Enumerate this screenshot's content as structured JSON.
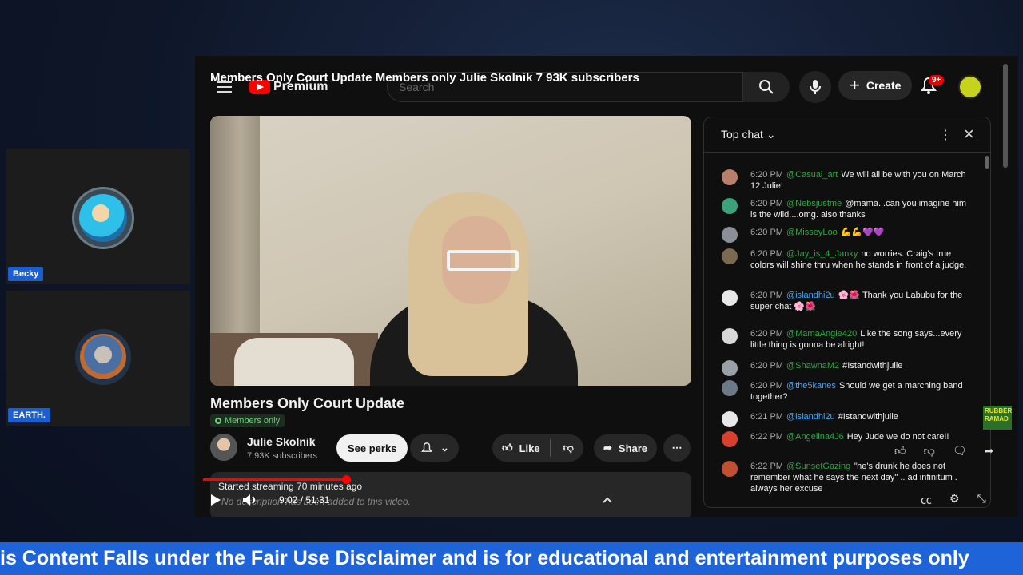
{
  "participants": [
    {
      "name": "Becky"
    },
    {
      "name": "EARTH."
    }
  ],
  "youtube": {
    "overlay_title": "Members Only Court Update Members only  Julie Skolnik 7 93K subscribers",
    "logo_text": "Premium",
    "search_placeholder": "Search",
    "create_label": "Create",
    "notif_badge": "9+"
  },
  "video": {
    "title": "Members Only Court Update",
    "members_badge": "Members only",
    "channel_name": "Julie Skolnik",
    "channel_subs": "7.93K subscribers",
    "perks_label": "See perks",
    "like_label": "Like",
    "share_label": "Share",
    "desc_line1": "Started streaming 70 minutes ago",
    "desc_line2": "No description has been added to this video.",
    "time": "9:02 / 51:31",
    "progress": 0.175
  },
  "chat": {
    "title": "Top chat",
    "messages": [
      {
        "time": "6:20 PM",
        "author": "@Casual_art",
        "text": "We will all be with you on March 12 Julie!",
        "color": "#b8806a"
      },
      {
        "time": "6:20 PM",
        "author": "@Nebsjustme",
        "text": "@mama...can you imagine him is the wild....omg. also thanks",
        "color": "#3aa37a"
      },
      {
        "time": "6:20 PM",
        "author": "@MisseyLoo",
        "text": "💪💪💜💜",
        "color": "#8a8f98"
      },
      {
        "time": "6:20 PM",
        "author": "@Jay_is_4_Janky",
        "text": "no worries. Craig's true colors will shine thru when he stands in front of a judge.",
        "color": "#7a6a50"
      },
      {
        "time": "6:20 PM",
        "author": "@islandhi2u",
        "text": "🌸🌺 Thank you Labubu for the super chat 🌸🌺",
        "color": "#e8e8e8",
        "blue": true
      },
      {
        "time": "6:20 PM",
        "author": "@MamaAngie420",
        "text": "Like the song says...every little thing is gonna be alright!",
        "color": "#d8d8d8"
      },
      {
        "time": "6:20 PM",
        "author": "@ShawnaM2",
        "text": "#Istandwithjulie",
        "color": "#9aa0a8"
      },
      {
        "time": "6:20 PM",
        "author": "@the5kanes",
        "text": "Should we get a marching band together?",
        "color": "#6c7a88",
        "blue": true
      },
      {
        "time": "6:21 PM",
        "author": "@islandhi2u",
        "text": "#Istandwithjuile",
        "color": "#e8e8e8",
        "blue": true
      },
      {
        "time": "6:22 PM",
        "author": "@Angelina4J6",
        "text": "Hey Jude we do not care!!",
        "color": "#d6402c"
      },
      {
        "time": "6:22 PM",
        "author": "@SunsetGazing",
        "text": "\"he's drunk he does not remember what he says the next day\" .. ad infinitum . always her excuse",
        "color": "#c05030"
      }
    ]
  },
  "ticker_text": "is Content Falls under the Fair Use Disclaimer and is for educational and entertainment purposes only",
  "side_logo_text": "RUBBER RAMAD",
  "colors": {
    "ticker": "#1e63d8",
    "name_tag": "#1a5fd0",
    "progress": "#ff0000"
  }
}
